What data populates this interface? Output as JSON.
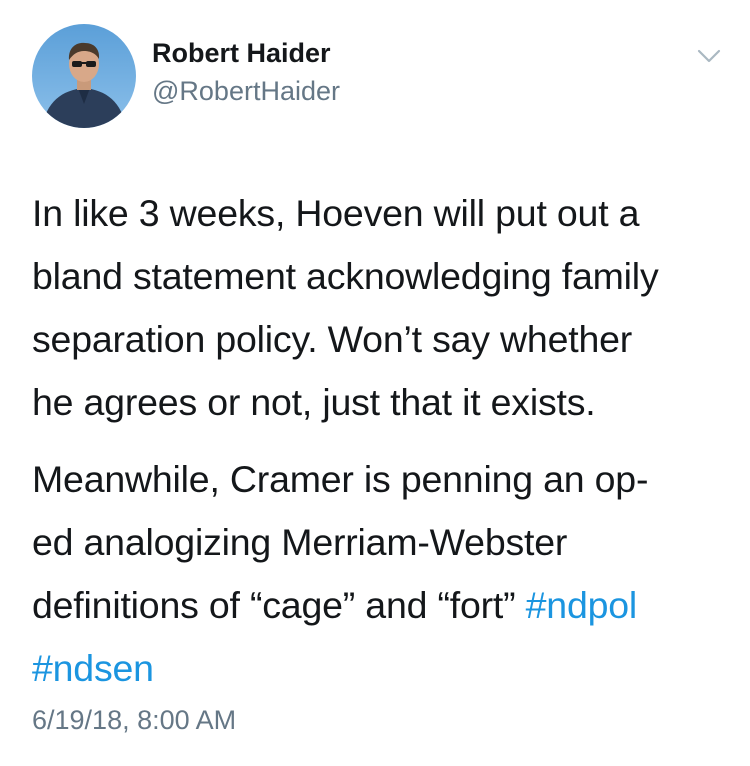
{
  "user": {
    "display_name": "Robert Haider",
    "handle": "@RobertHaider"
  },
  "tweet": {
    "para1_lines": [
      "In like 3 weeks, Hoeven will put out a",
      "bland statement acknowledging family",
      "separation policy. Won’t say whether",
      "he agrees or not, just that it exists."
    ],
    "para2_lines": [
      "Meanwhile, Cramer is penning an op-",
      "ed analogizing Merriam-Webster",
      "definitions of “cage” and “fort” "
    ],
    "hashtags": [
      "#ndpol",
      "#ndsen"
    ],
    "timestamp": "6/19/18, 8:00 AM"
  },
  "colors": {
    "text": "#14171a",
    "secondary": "#657786",
    "link": "#1b95e0"
  },
  "icons": {
    "menu": "chevron-down-icon"
  }
}
